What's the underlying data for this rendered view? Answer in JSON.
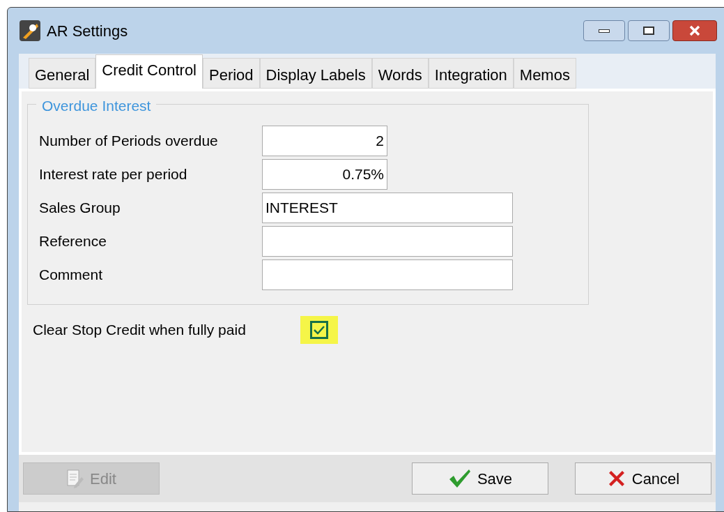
{
  "window": {
    "title": "AR Settings"
  },
  "tabs": [
    {
      "label": "General",
      "selected": false
    },
    {
      "label": "Credit Control",
      "selected": true
    },
    {
      "label": "Period",
      "selected": false
    },
    {
      "label": "Display Labels",
      "selected": false
    },
    {
      "label": "Words",
      "selected": false
    },
    {
      "label": "Integration",
      "selected": false
    },
    {
      "label": "Memos",
      "selected": false
    }
  ],
  "group": {
    "title": "Overdue Interest",
    "fields": [
      {
        "label": "Number of Periods overdue",
        "value": "2",
        "kind": "number"
      },
      {
        "label": "Interest rate per period",
        "value": "0.75%",
        "kind": "number"
      },
      {
        "label": "Sales Group",
        "value": "INTEREST",
        "kind": "text"
      },
      {
        "label": "Reference",
        "kind": "text"
      },
      {
        "label": "Comment",
        "kind": "text"
      }
    ]
  },
  "clear_stop_credit": {
    "label": "Clear Stop Credit when fully paid",
    "checked": true
  },
  "buttons": [
    {
      "label": "Edit",
      "kind": "edit",
      "disabled": true
    },
    {
      "label": "Save",
      "kind": "save",
      "disabled": false
    },
    {
      "label": "Cancel",
      "kind": "cancel",
      "disabled": false
    }
  ]
}
